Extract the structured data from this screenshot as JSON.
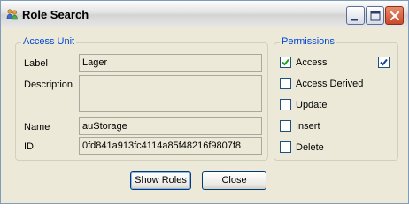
{
  "window": {
    "title": "Role Search",
    "icon": "people-icon"
  },
  "access_unit": {
    "group_label": "Access Unit",
    "label_caption": "Label",
    "label_value": "Lager",
    "description_caption": "Description",
    "description_value": "",
    "name_caption": "Name",
    "name_value": "auStorage",
    "id_caption": "ID",
    "id_value": "0fd841a913fc4114a85f48216f9807f8"
  },
  "permissions": {
    "group_label": "Permissions",
    "items": [
      {
        "label": "Access",
        "checked": true
      },
      {
        "label": "Access Derived",
        "checked": false
      },
      {
        "label": "Update",
        "checked": false
      },
      {
        "label": "Insert",
        "checked": false
      },
      {
        "label": "Delete",
        "checked": false
      }
    ],
    "extra_checkbox_checked": true
  },
  "buttons": {
    "show_roles": "Show Roles",
    "close": "Close"
  },
  "colors": {
    "group_title": "#0046d5",
    "check_mark": "#21a121",
    "extra_check_mark": "#1c3f94"
  }
}
